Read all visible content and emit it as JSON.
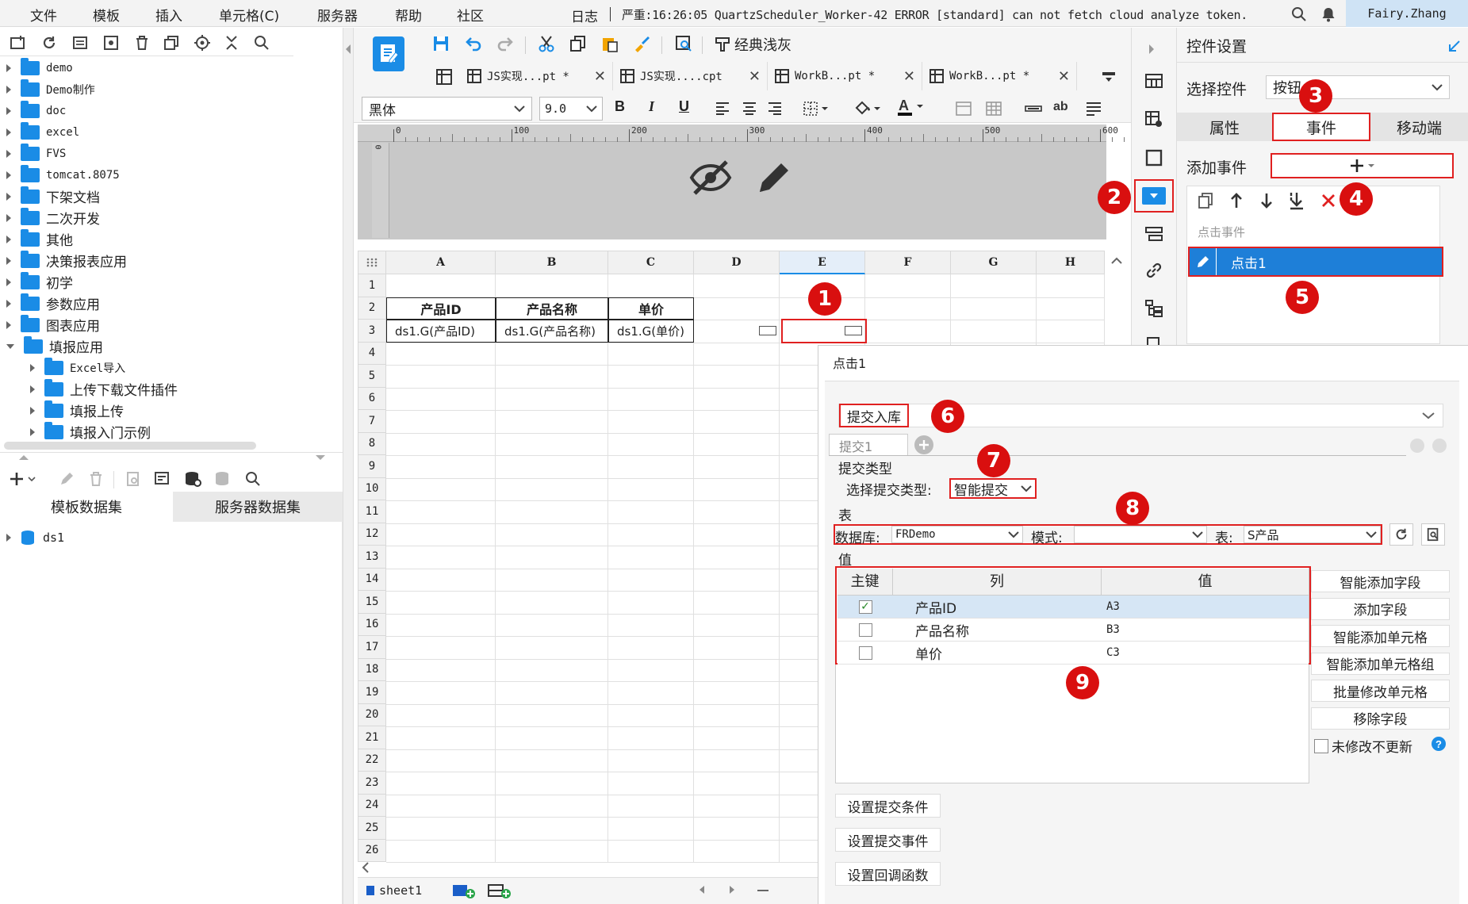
{
  "menubar": {
    "items": [
      "文件",
      "模板",
      "插入",
      "单元格(C)",
      "服务器",
      "帮助",
      "社区"
    ],
    "log_label": "日志",
    "log_message": "严重:16:26:05 QuartzScheduler_Worker-42 ERROR [standard] can not fetch cloud analyze token.",
    "user": "Fairy.Zhang"
  },
  "file_tree": {
    "items": [
      {
        "label": "demo",
        "level": 0,
        "open": false
      },
      {
        "label": "Demo制作",
        "level": 0,
        "open": false
      },
      {
        "label": "doc",
        "level": 0,
        "open": false
      },
      {
        "label": "excel",
        "level": 0,
        "open": false
      },
      {
        "label": "FVS",
        "level": 0,
        "open": false
      },
      {
        "label": "tomcat.8075",
        "level": 0,
        "open": false
      },
      {
        "label": "下架文档",
        "level": 0,
        "open": false
      },
      {
        "label": "二次开发",
        "level": 0,
        "open": false
      },
      {
        "label": "其他",
        "level": 0,
        "open": false
      },
      {
        "label": "决策报表应用",
        "level": 0,
        "open": false
      },
      {
        "label": "初学",
        "level": 0,
        "open": false
      },
      {
        "label": "参数应用",
        "level": 0,
        "open": false
      },
      {
        "label": "图表应用",
        "level": 0,
        "open": false
      },
      {
        "label": "填报应用",
        "level": 0,
        "open": true
      },
      {
        "label": "Excel导入",
        "level": 1,
        "open": false
      },
      {
        "label": "上传下载文件插件",
        "level": 1,
        "open": false
      },
      {
        "label": "填报上传",
        "level": 1,
        "open": false
      },
      {
        "label": "填报入门示例",
        "level": 1,
        "open": false
      }
    ]
  },
  "dataset_panel": {
    "tabs": [
      "模板数据集",
      "服务器数据集"
    ],
    "datasets": [
      "ds1"
    ]
  },
  "editor_toolbar": {
    "style_button": "经典浅灰",
    "tabs": [
      "JS实现...pt *",
      "JS实现....cpt",
      "WorkB...pt *",
      "WorkB...pt *"
    ],
    "font_name": "黑体",
    "font_size": "9.0"
  },
  "ruler": {
    "ticks": [
      "0",
      "100",
      "200",
      "300",
      "400",
      "500",
      "600"
    ]
  },
  "sheet": {
    "columns": [
      "A",
      "B",
      "C",
      "D",
      "E",
      "F",
      "G",
      "H"
    ],
    "rows": [
      "1",
      "2",
      "3",
      "4",
      "5",
      "6",
      "7",
      "8",
      "9",
      "10",
      "11",
      "12",
      "13",
      "14",
      "15",
      "16",
      "17",
      "18",
      "19",
      "20",
      "21",
      "22",
      "23",
      "24",
      "25",
      "26"
    ],
    "header_cells": [
      "产品ID",
      "产品名称",
      "单价"
    ],
    "data_cells": [
      "ds1.G(产品ID)",
      "ds1.G(产品名称)",
      "ds1.G(单价)"
    ],
    "sheet_tab": "sheet1"
  },
  "control_settings": {
    "title": "控件设置",
    "select_label": "选择控件",
    "select_value": "按钮",
    "tabs": [
      "属性",
      "事件",
      "移动端"
    ],
    "add_event_label": "添加事件",
    "event_group": "点击事件",
    "event_item": "点击1"
  },
  "event_dialog": {
    "title": "点击1",
    "action": "提交入库",
    "submit_tab": "提交1",
    "submit_type_section": "提交类型",
    "submit_type_label": "选择提交类型:",
    "submit_type_value": "智能提交",
    "table_section": "表",
    "db_label": "数据库:",
    "db_value": "FRDemo",
    "schema_label": "模式:",
    "schema_value": "",
    "table_label": "表:",
    "table_value": "S产品",
    "value_section": "值",
    "grid_headers": [
      "主键",
      "列",
      "值"
    ],
    "grid_rows": [
      {
        "key": true,
        "column": "产品ID",
        "value": "A3"
      },
      {
        "key": false,
        "column": "产品名称",
        "value": "B3"
      },
      {
        "key": false,
        "column": "单价",
        "value": "C3"
      }
    ],
    "side_buttons": [
      "智能添加字段",
      "添加字段",
      "智能添加单元格",
      "智能添加单元格组",
      "批量修改单元格",
      "移除字段"
    ],
    "no_update_label": "未修改不更新",
    "bottom_buttons": [
      "设置提交条件",
      "设置提交事件",
      "设置回调函数"
    ]
  },
  "annotations": [
    "1",
    "2",
    "3",
    "4",
    "5",
    "6",
    "7",
    "8",
    "9"
  ],
  "colors": {
    "accent": "#1a8ce6",
    "selection": "#1e7fd8",
    "annotation": "#d90f0f",
    "toolbar_bg": "#f5f5f5"
  }
}
